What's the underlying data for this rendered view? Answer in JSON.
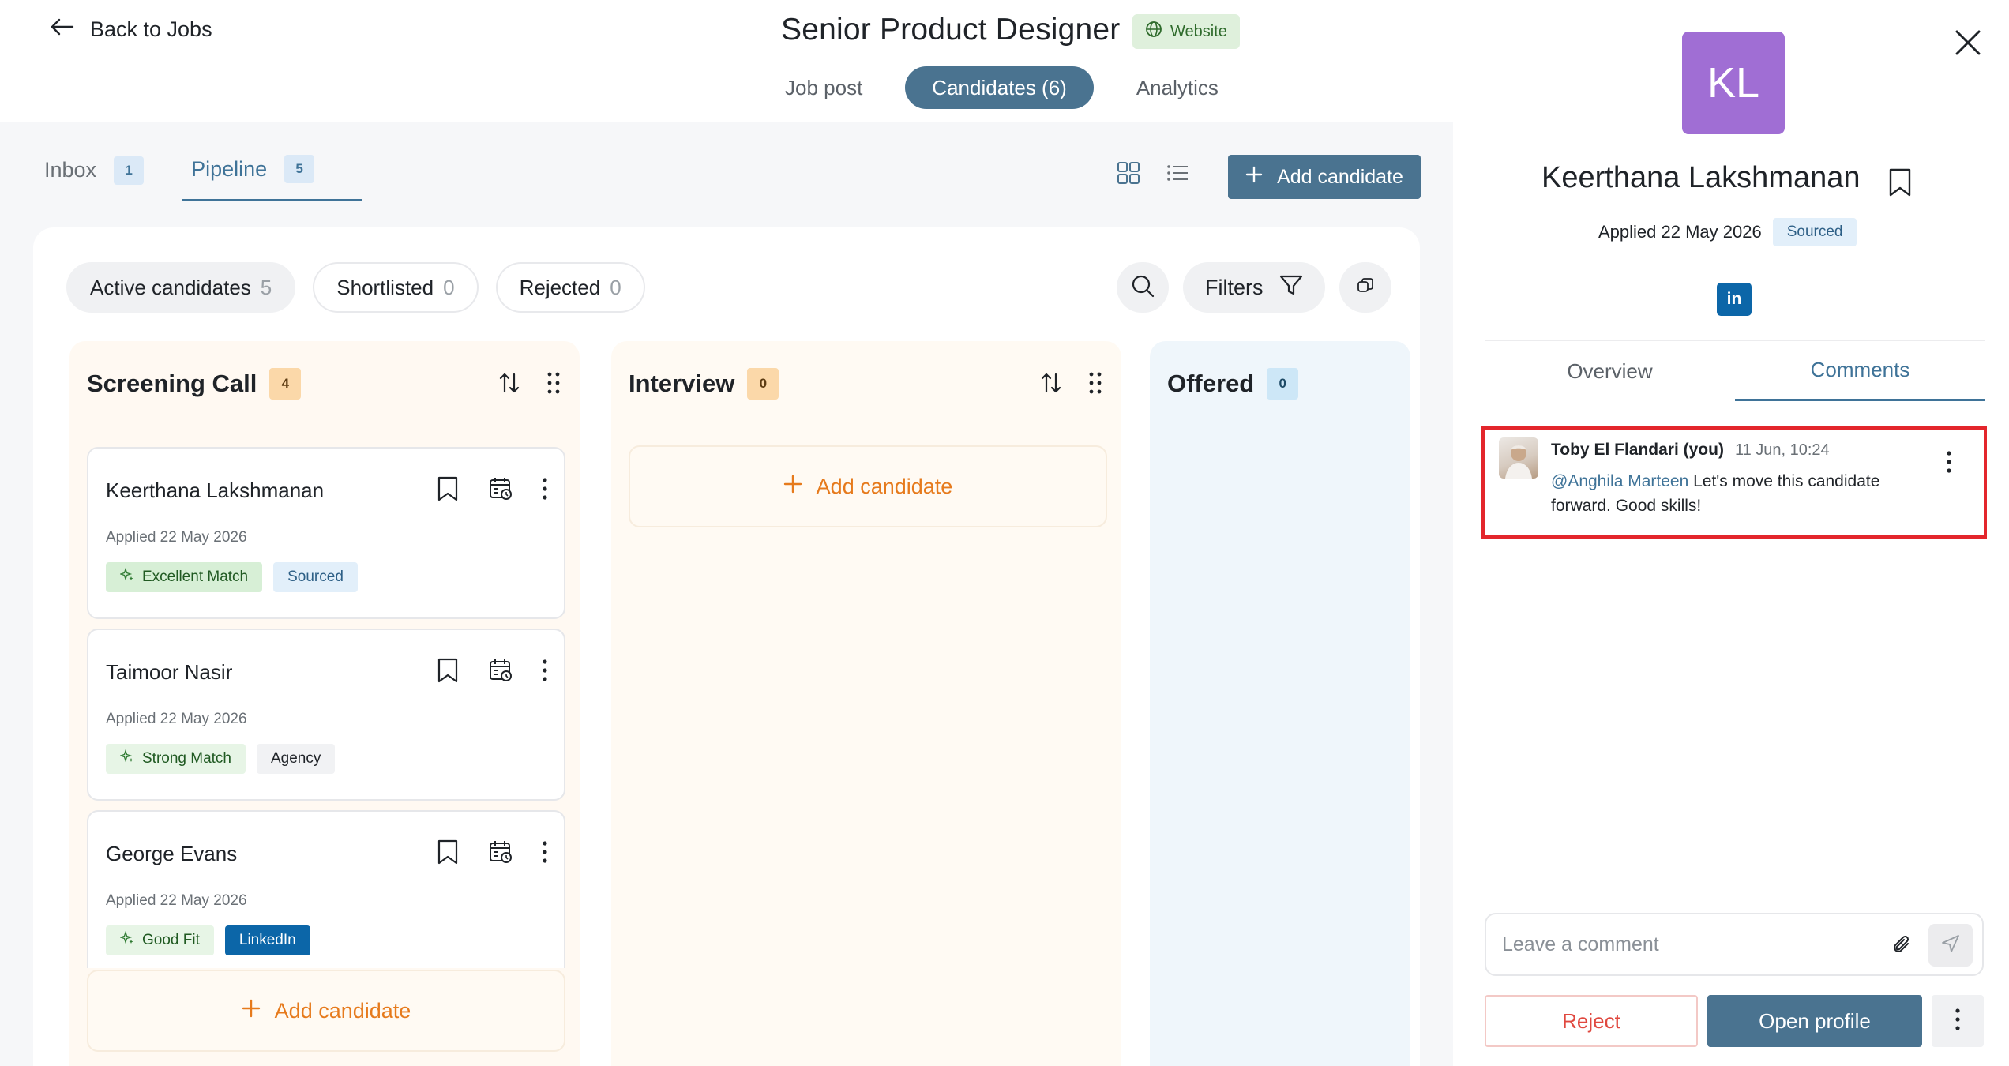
{
  "header": {
    "back_label": "Back to Jobs",
    "job_title": "Senior Product Designer",
    "source_badge": "Website",
    "tabs": [
      {
        "label": "Job post"
      },
      {
        "label": "Candidates (6)"
      },
      {
        "label": "Analytics"
      }
    ]
  },
  "subnav": {
    "tabs": [
      {
        "label": "Inbox",
        "count": "1"
      },
      {
        "label": "Pipeline",
        "count": "5"
      }
    ],
    "add_candidate": "Add candidate"
  },
  "filters": {
    "chips": [
      {
        "label": "Active candidates",
        "count": "5"
      },
      {
        "label": "Shortlisted",
        "count": "0"
      },
      {
        "label": "Rejected",
        "count": "0"
      }
    ],
    "filters_label": "Filters"
  },
  "columns": [
    {
      "title": "Screening Call",
      "count": "4",
      "cards": [
        {
          "name": "Keerthana Lakshmanan",
          "applied": "Applied 22 May 2026",
          "tags": [
            "Excellent Match",
            "Sourced"
          ]
        },
        {
          "name": "Taimoor Nasir",
          "applied": "Applied 22 May 2026",
          "tags": [
            "Strong Match",
            "Agency"
          ]
        },
        {
          "name": "George Evans",
          "applied": "Applied 22 May 2026",
          "tags": [
            "Good Fit",
            "LinkedIn"
          ]
        }
      ],
      "add_label": "Add candidate"
    },
    {
      "title": "Interview",
      "count": "0",
      "add_label": "Add candidate"
    },
    {
      "title": "Offered",
      "count": "0"
    }
  ],
  "panel": {
    "initials": "KL",
    "name": "Keerthana Lakshmanan",
    "applied": "Applied 22 May 2026",
    "source": "Sourced",
    "linkedin": "in",
    "tabs": [
      {
        "label": "Overview"
      },
      {
        "label": "Comments"
      }
    ],
    "comment": {
      "author": "Toby El Flandari (you)",
      "time": "11 Jun, 10:24",
      "mention": "@Anghila Marteen",
      "text": " Let's move this candidate forward. Good skills!"
    },
    "comment_placeholder": "Leave a comment",
    "reject_label": "Reject",
    "open_profile_label": "Open profile"
  },
  "colors": {
    "primary": "#4a7390",
    "accent_orange": "#e67a1c",
    "avatar_purple": "#a06ed4",
    "highlight_red": "#e3262c"
  }
}
